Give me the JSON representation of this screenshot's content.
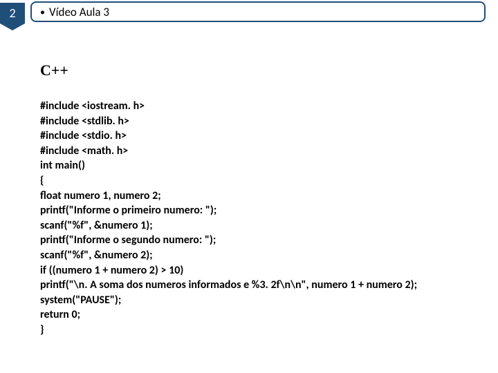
{
  "header": {
    "slide_number": "2",
    "title": "Vídeo Aula 3"
  },
  "content": {
    "lang_title": "C++",
    "code_lines": [
      "#include <iostream. h>",
      "#include <stdlib. h>",
      "#include <stdio. h>",
      "#include <math. h>",
      "int main()",
      "{",
      "float numero 1, numero 2;",
      "printf(\"Informe o primeiro numero: \");",
      "scanf(\"%f\", &numero 1);",
      "printf(\"Informe o segundo numero: \");",
      "scanf(\"%f\", &numero 2);",
      "if ((numero 1 + numero 2) > 10)",
      "printf(\"\\n. A soma dos numeros informados e %3. 2f\\n\\n\", numero 1 + numero 2);",
      "system(\"PAUSE\");",
      "return 0;",
      "}"
    ]
  }
}
